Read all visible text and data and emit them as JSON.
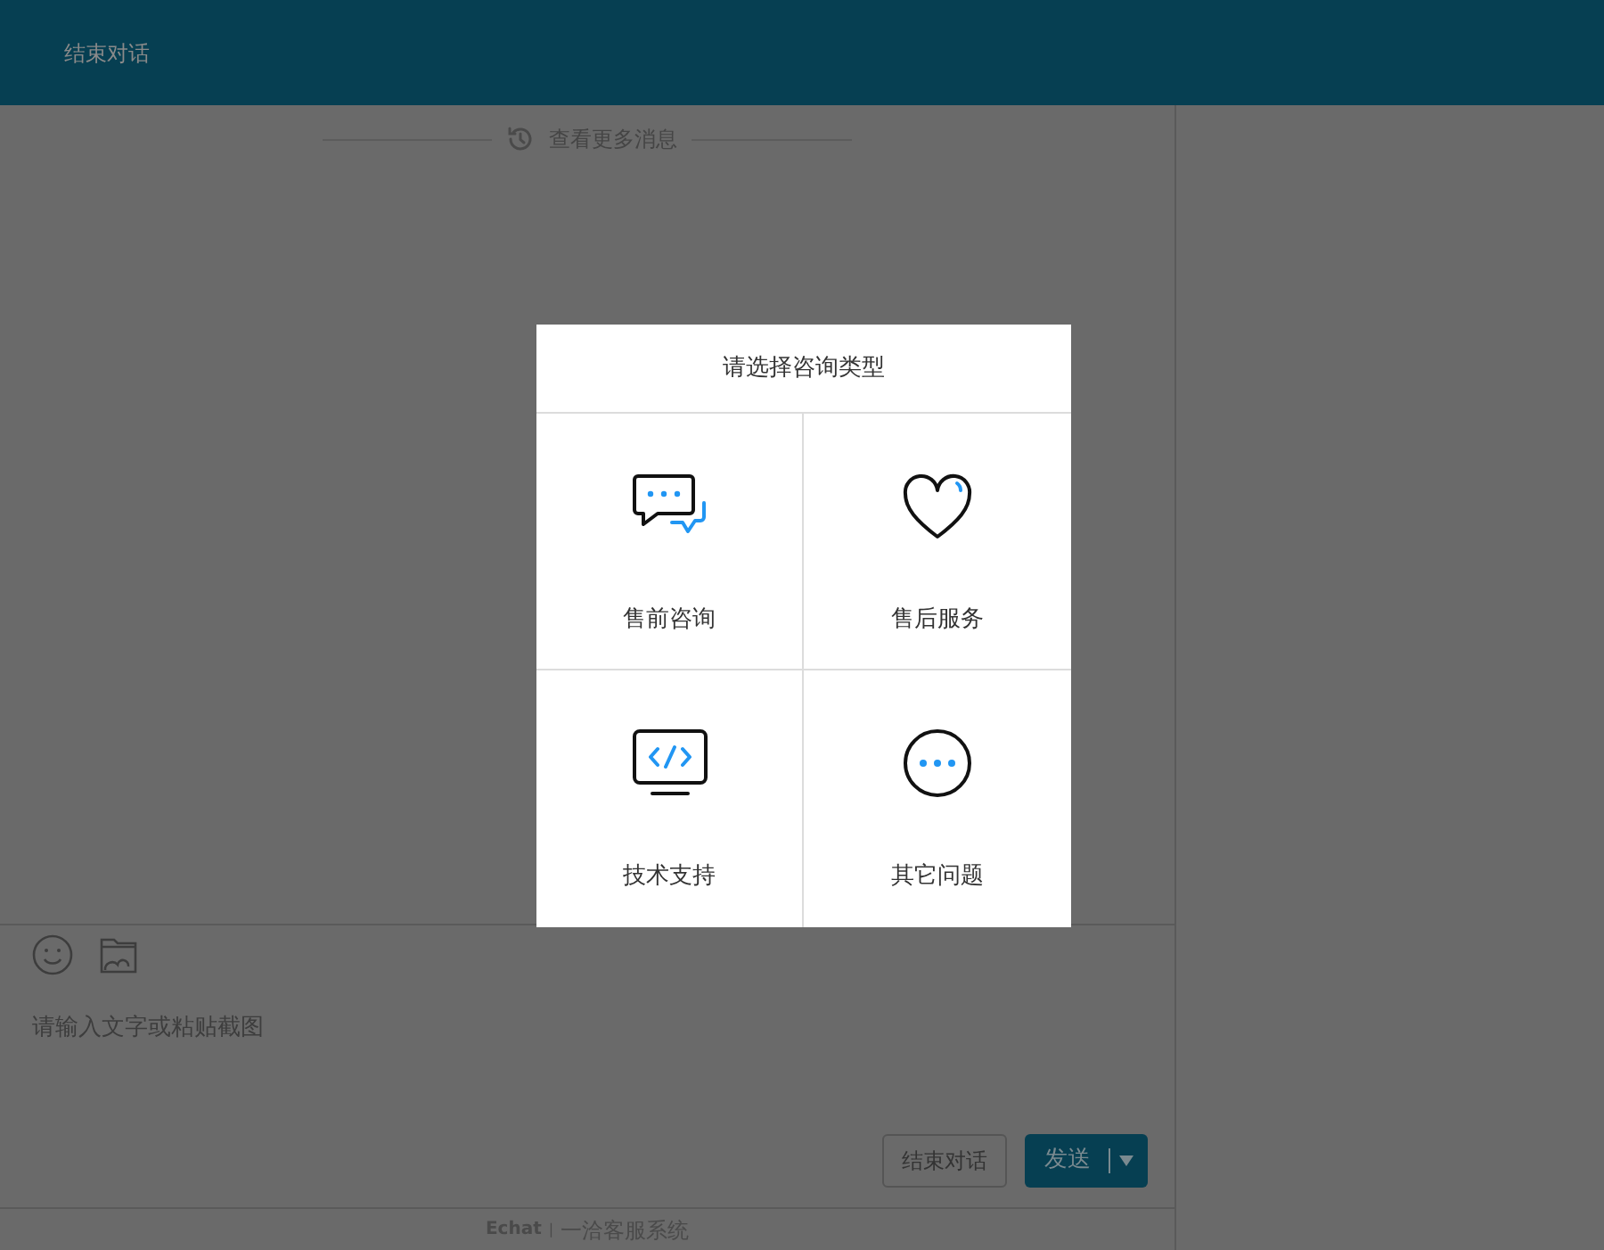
{
  "header": {
    "end_chat_link": "结束对话"
  },
  "history": {
    "label": "查看更多消息"
  },
  "modal": {
    "title": "请选择咨询类型",
    "options": [
      {
        "kind": "chat",
        "label": "售前咨询"
      },
      {
        "kind": "heart",
        "label": "售后服务"
      },
      {
        "kind": "code",
        "label": "技术支持"
      },
      {
        "kind": "more",
        "label": "其它问题"
      }
    ]
  },
  "composer": {
    "placeholder": "请输入文字或粘贴截图"
  },
  "buttons": {
    "end_chat": "结束对话",
    "send": "发送"
  },
  "footer": {
    "logo": "Echat",
    "separator": "|",
    "product": "一洽客服系统"
  }
}
